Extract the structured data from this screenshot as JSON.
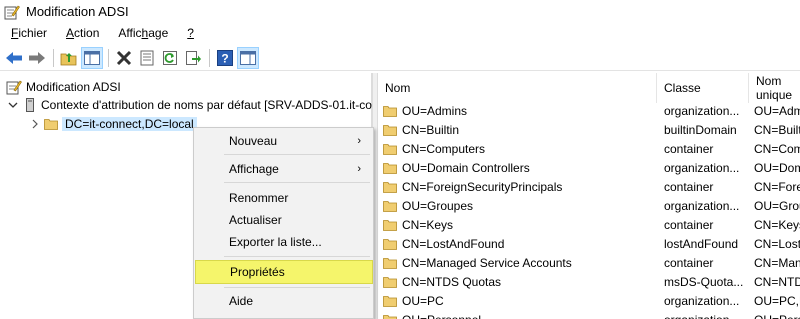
{
  "window": {
    "title": "Modification ADSI"
  },
  "menubar": {
    "items": [
      {
        "label": "Fichier",
        "accel": "F"
      },
      {
        "label": "Action",
        "accel": "A"
      },
      {
        "label": "Affichage",
        "accel": "h"
      },
      {
        "label": "?",
        "accel": "?"
      }
    ]
  },
  "toolbar": {
    "icons": [
      "back-arrow-icon",
      "forward-arrow-icon",
      "up-folder-icon",
      "show-hide-tree-icon",
      "delete-icon",
      "properties-icon",
      "refresh-icon",
      "export-list-icon",
      "help-icon",
      "action-pane-icon"
    ]
  },
  "tree": {
    "root": "Modification ADSI",
    "context": "Contexte d'attribution de noms par défaut [SRV-ADDS-01.it-co",
    "node": "DC=it-connect,DC=local"
  },
  "list": {
    "columns": [
      "Nom",
      "Classe",
      "Nom unique"
    ],
    "rows": [
      {
        "name": "OU=Admins",
        "class": "organization...",
        "dn": "OU=Admins"
      },
      {
        "name": "CN=Builtin",
        "class": "builtinDomain",
        "dn": "CN=Builtin"
      },
      {
        "name": "CN=Computers",
        "class": "container",
        "dn": "CN=Computers"
      },
      {
        "name": "OU=Domain Controllers",
        "class": "organization...",
        "dn": "OU=Domain"
      },
      {
        "name": "CN=ForeignSecurityPrincipals",
        "class": "container",
        "dn": "CN=Foreign"
      },
      {
        "name": "OU=Groupes",
        "class": "organization...",
        "dn": "OU=Groupes"
      },
      {
        "name": "CN=Keys",
        "class": "container",
        "dn": "CN=Keys"
      },
      {
        "name": "CN=LostAndFound",
        "class": "lostAndFound",
        "dn": "CN=LostAndFound"
      },
      {
        "name": "CN=Managed Service Accounts",
        "class": "container",
        "dn": "CN=Managed"
      },
      {
        "name": "CN=NTDS Quotas",
        "class": "msDS-Quota...",
        "dn": "CN=NTDS"
      },
      {
        "name": "OU=PC",
        "class": "organization...",
        "dn": "OU=PC,DC="
      },
      {
        "name": "OU=Personnel",
        "class": "organization...",
        "dn": "OU=Personnel"
      }
    ]
  },
  "context_menu": {
    "items": [
      {
        "label": "Nouveau",
        "submenu": "›"
      },
      {
        "label": "Affichage",
        "submenu": "›"
      },
      {
        "label": "Renommer"
      },
      {
        "label": "Actualiser"
      },
      {
        "label": "Exporter la liste..."
      },
      {
        "label": "Propriétés"
      },
      {
        "label": "Aide"
      }
    ]
  },
  "colors": {
    "highlight": "#f5f56b",
    "selection": "#cce8ff",
    "folder": "#dcb04c"
  }
}
